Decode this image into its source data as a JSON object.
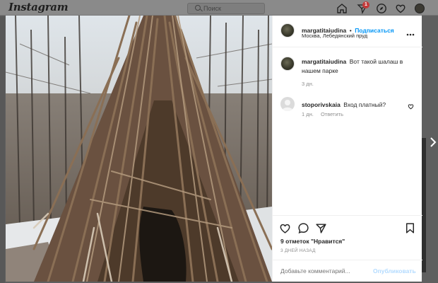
{
  "header": {
    "logo": "Instagram",
    "search_placeholder": "Поиск",
    "notification_count": "1"
  },
  "post": {
    "author": "margatitaiudina",
    "separator": "•",
    "follow_label": "Подписаться",
    "location": "Москва, Лебедянский пруд",
    "caption_text": "Вот такой шалаш в нашем парке",
    "caption_age": "3 дн.",
    "comments": [
      {
        "username": "stoporivskaia",
        "text": "Вход платный?",
        "age": "1 дн.",
        "reply_label": "Ответить"
      }
    ],
    "likes": "9 отметок \"Нравится\"",
    "date": "3 ДНЕЙ НАЗАД",
    "comment_placeholder": "Добавьте комментарий...",
    "publish_label": "Опубликовать"
  },
  "colors": {
    "link_blue": "#0095f6",
    "publish_disabled": "#b3dbff",
    "overlay": "#5f5f5f"
  },
  "icons": [
    "home-icon",
    "direct-icon",
    "explore-icon",
    "heart-icon",
    "more-icon",
    "like-icon",
    "comment-icon",
    "share-icon",
    "save-icon",
    "next-arrow-icon"
  ]
}
